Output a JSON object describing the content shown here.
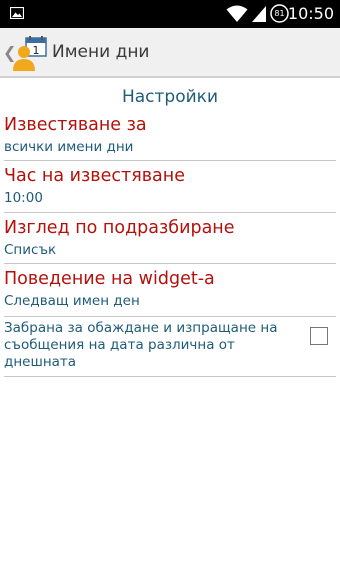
{
  "status_bar": {
    "battery_level": "81",
    "time": "10:50"
  },
  "action_bar": {
    "back_icon": "chevron-left-icon",
    "app_icon": "person-calendar-icon",
    "title": "Имени дни"
  },
  "settings": {
    "header": "Настройки",
    "items": [
      {
        "title": "Известяване за",
        "summary": "всички имени дни"
      },
      {
        "title": "Час на известяване",
        "summary": "10:00"
      },
      {
        "title": "Изглед по подразбиране",
        "summary": "Списък"
      },
      {
        "title": "Поведение на widget-а",
        "summary": "Следващ имен ден"
      }
    ],
    "checkbox_item": {
      "label": "Забрана за обаждане и изпращане на съобщения на дата различна от днешната",
      "checked": false
    }
  },
  "colors": {
    "title_red": "#b3120c",
    "summary_blue": "#1e5c7a",
    "actionbar_bg": "#f0f0f0",
    "icon_orange": "#f0a81c"
  }
}
